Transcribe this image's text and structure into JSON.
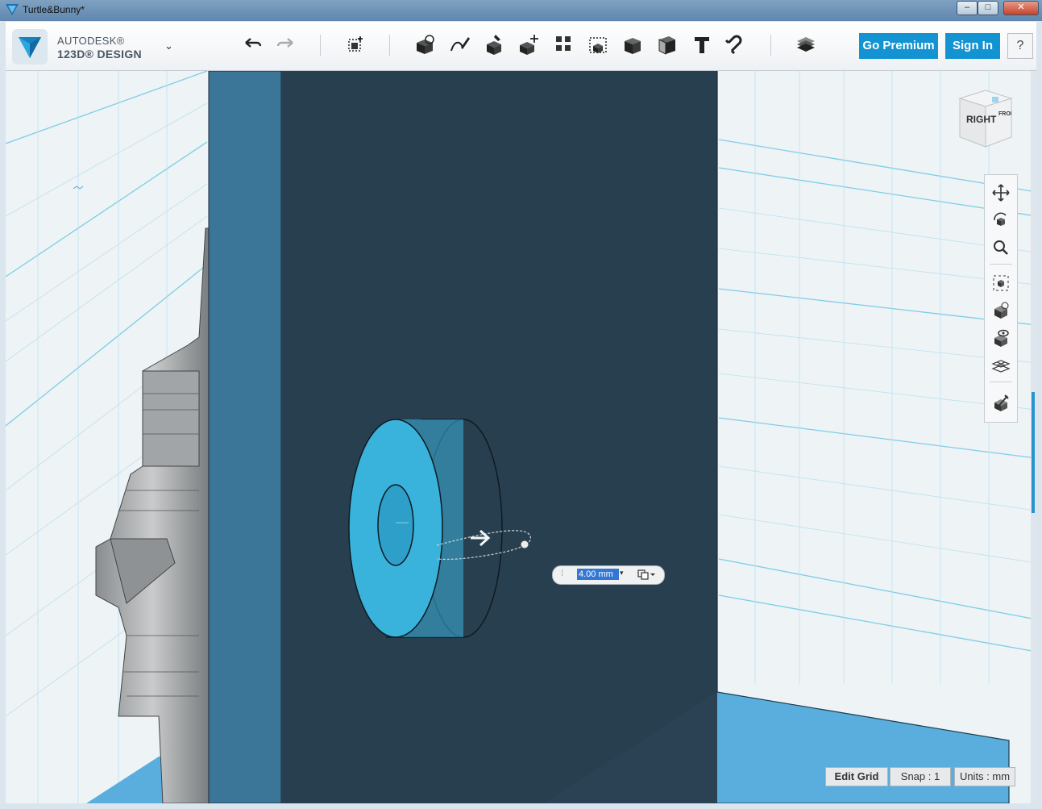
{
  "window": {
    "title": "Turtle&Bunny*",
    "minimize_icon": "minimize-icon",
    "maximize_icon": "maximize-icon",
    "close_icon": "close-icon",
    "close_label": "✕"
  },
  "brand": {
    "line1": "AUTODESK®",
    "line2": "123D® DESIGN",
    "menu_glyph": "⌄"
  },
  "toolbar": {
    "tools": [
      "undo-icon",
      "redo-icon",
      "transform-icon",
      "primitives-icon",
      "sketch-icon",
      "construct-icon",
      "modify-icon",
      "pattern-icon",
      "grouping-icon",
      "combine-icon",
      "measure-icon",
      "text-icon",
      "snap-icon",
      "material-icon"
    ],
    "go_premium": "Go Premium",
    "sign_in": "Sign In",
    "help": "?"
  },
  "viewcube": {
    "face_right": "RIGHT",
    "face_front": "FRONT"
  },
  "nav": {
    "tools": [
      "pan-icon",
      "orbit-icon",
      "zoom-icon",
      "fit-icon",
      "view-icon",
      "visibility-icon",
      "grid-toggle-icon",
      "material-icon"
    ]
  },
  "dimension": {
    "value": "4.00 mm",
    "caret": "▾"
  },
  "status": {
    "edit_grid": "Edit Grid",
    "snap": "Snap : 1",
    "units": "Units : mm"
  },
  "colors": {
    "accent": "#1393d2",
    "wall_face": "#283f4f",
    "wall_edge": "#3b7699",
    "cylinder": "#3ab3dc",
    "base_plate": "#5bafde",
    "grid_line": "#56c3e6",
    "gear": "#b3b6b8"
  }
}
